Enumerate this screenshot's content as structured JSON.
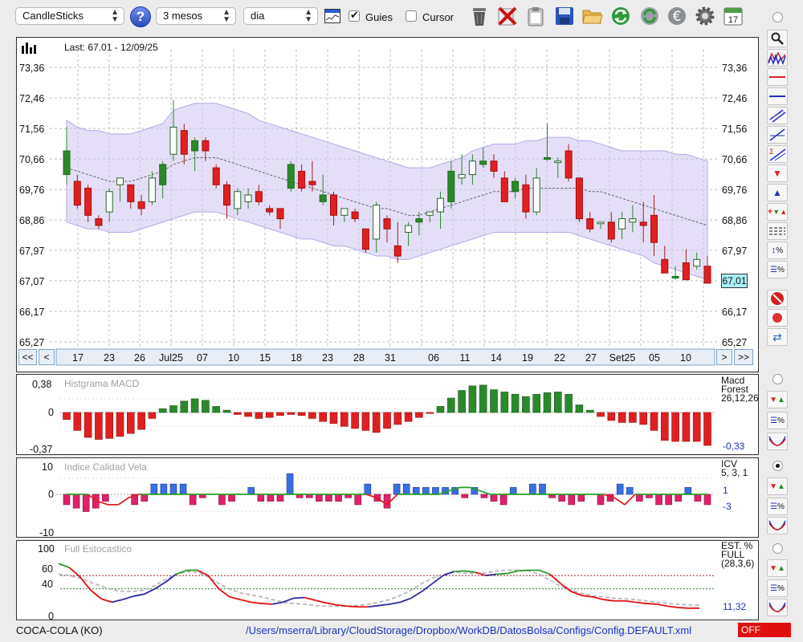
{
  "toolbar": {
    "chart_type": "CandleSticks",
    "period": "3 mesos",
    "interval": "dia",
    "guides_label": "Guies",
    "guides_checked": true,
    "cursor_label": "Cursor",
    "cursor_checked": false,
    "calendar_day": "17",
    "help_glyph": "?",
    "icons": [
      "help-icon",
      "chart-window-icon",
      "trash-icon",
      "delete-icon",
      "clipboard-icon",
      "save-icon",
      "folder-icon",
      "refresh-icon",
      "update-icon",
      "euro-icon",
      "settings-icon",
      "calendar-icon"
    ]
  },
  "main_chart": {
    "last_label": "Last: 67.01 - 12/09/25",
    "current_value": "67,01",
    "price_axis": [
      "73,36",
      "72,46",
      "71,56",
      "70,66",
      "69,76",
      "68,86",
      "67,97",
      "67,07",
      "66,17",
      "65,27"
    ],
    "date_labels": [
      "17",
      "23",
      "26",
      "Jul25",
      "07",
      "10",
      "15",
      "18",
      "23",
      "28",
      "31",
      "06",
      "11",
      "14",
      "19",
      "22",
      "27",
      "Set25",
      "05",
      "10"
    ],
    "nav": {
      "first": "<<",
      "prev": "<",
      "next": ">",
      "last": ">>"
    }
  },
  "macd": {
    "title": "Histgrama MACD",
    "axis": [
      "0,38",
      "0",
      "-0,37"
    ],
    "name_line1": "Macd",
    "name_line2": "Forest",
    "params": "26,12,26",
    "value": "-0,33"
  },
  "icv": {
    "title": "Indice Calidad Vela",
    "axis": [
      "10",
      "0",
      "-10"
    ],
    "name": "ICV",
    "params": "5, 3, 1",
    "value1": "1",
    "value2": "-3"
  },
  "stoch": {
    "title": "Full Estocastico",
    "axis": [
      "100",
      "60",
      "40",
      "0"
    ],
    "name_line1": "EST. %",
    "name_line2": "FULL",
    "params": "(28,3,6)",
    "value": "11,32"
  },
  "status": {
    "symbol": "COCA-COLA (KO)",
    "path": "/Users/mserra/Library/CloudStorage/Dropbox/WorkDB/DatosBolsa/Configs/Config.DEFAULT.xml",
    "mode": "OFF"
  },
  "colors": {
    "up": "#2a8a2a",
    "down": "#e02020",
    "band": "#cdc4f0",
    "accent": "#2030c0",
    "highlight": "#a8f0f8"
  },
  "chart_data": [
    {
      "type": "candlestick",
      "title": "Last: 67.01 - 12/09/25",
      "ylim": [
        65.27,
        73.36
      ],
      "y_ticks": [
        73.36,
        72.46,
        71.56,
        70.66,
        69.76,
        68.86,
        67.97,
        67.07,
        66.17,
        65.27
      ],
      "x_tick_labels": [
        "17",
        "23",
        "26",
        "Jul25",
        "07",
        "10",
        "15",
        "18",
        "23",
        "28",
        "31",
        "06",
        "11",
        "14",
        "19",
        "22",
        "27",
        "Set25",
        "05",
        "10"
      ],
      "candles": [
        {
          "o": 70.2,
          "h": 71.6,
          "l": 69.9,
          "c": 70.9
        },
        {
          "o": 70.0,
          "h": 70.2,
          "l": 69.2,
          "c": 69.3
        },
        {
          "o": 69.8,
          "h": 69.9,
          "l": 68.8,
          "c": 69.0
        },
        {
          "o": 68.9,
          "h": 69.0,
          "l": 68.6,
          "c": 68.7
        },
        {
          "o": 69.1,
          "h": 69.8,
          "l": 68.8,
          "c": 69.7
        },
        {
          "o": 69.9,
          "h": 70.1,
          "l": 69.4,
          "c": 70.1
        },
        {
          "o": 69.9,
          "h": 69.9,
          "l": 69.2,
          "c": 69.4
        },
        {
          "o": 69.4,
          "h": 69.6,
          "l": 69.0,
          "c": 69.2
        },
        {
          "o": 69.4,
          "h": 70.3,
          "l": 69.3,
          "c": 70.1
        },
        {
          "o": 69.9,
          "h": 70.6,
          "l": 69.5,
          "c": 70.5
        },
        {
          "o": 70.8,
          "h": 72.4,
          "l": 70.6,
          "c": 71.6
        },
        {
          "o": 71.5,
          "h": 71.7,
          "l": 70.5,
          "c": 70.8
        },
        {
          "o": 70.9,
          "h": 71.3,
          "l": 70.3,
          "c": 71.2
        },
        {
          "o": 71.2,
          "h": 71.3,
          "l": 70.6,
          "c": 70.9
        },
        {
          "o": 70.4,
          "h": 70.5,
          "l": 69.8,
          "c": 69.9
        },
        {
          "o": 69.9,
          "h": 70.0,
          "l": 68.9,
          "c": 69.3
        },
        {
          "o": 69.2,
          "h": 69.8,
          "l": 69.0,
          "c": 69.7
        },
        {
          "o": 69.4,
          "h": 69.8,
          "l": 69.2,
          "c": 69.6
        },
        {
          "o": 69.7,
          "h": 69.9,
          "l": 69.3,
          "c": 69.4
        },
        {
          "o": 69.2,
          "h": 69.3,
          "l": 69.0,
          "c": 69.1
        },
        {
          "o": 69.2,
          "h": 69.2,
          "l": 68.6,
          "c": 68.9
        },
        {
          "o": 69.8,
          "h": 70.6,
          "l": 69.7,
          "c": 70.5
        },
        {
          "o": 70.3,
          "h": 70.5,
          "l": 69.7,
          "c": 69.8
        },
        {
          "o": 70.0,
          "h": 70.6,
          "l": 69.7,
          "c": 69.9
        },
        {
          "o": 69.4,
          "h": 70.2,
          "l": 69.3,
          "c": 69.6
        },
        {
          "o": 69.6,
          "h": 69.7,
          "l": 68.7,
          "c": 69.0
        },
        {
          "o": 69.0,
          "h": 69.2,
          "l": 68.8,
          "c": 69.2
        },
        {
          "o": 69.1,
          "h": 69.2,
          "l": 68.8,
          "c": 68.9
        },
        {
          "o": 68.6,
          "h": 68.6,
          "l": 67.9,
          "c": 68.0
        },
        {
          "o": 68.3,
          "h": 69.4,
          "l": 67.9,
          "c": 69.3
        },
        {
          "o": 68.9,
          "h": 69.0,
          "l": 68.2,
          "c": 68.6
        },
        {
          "o": 68.1,
          "h": 68.8,
          "l": 67.6,
          "c": 67.8
        },
        {
          "o": 68.5,
          "h": 68.8,
          "l": 68.1,
          "c": 68.7
        },
        {
          "o": 68.8,
          "h": 69.1,
          "l": 68.4,
          "c": 68.9
        },
        {
          "o": 69.0,
          "h": 69.1,
          "l": 68.8,
          "c": 69.1
        },
        {
          "o": 69.1,
          "h": 69.7,
          "l": 68.6,
          "c": 69.5
        },
        {
          "o": 69.4,
          "h": 70.6,
          "l": 69.2,
          "c": 70.3
        },
        {
          "o": 70.1,
          "h": 70.8,
          "l": 69.9,
          "c": 70.2
        },
        {
          "o": 70.2,
          "h": 70.8,
          "l": 69.9,
          "c": 70.6
        },
        {
          "o": 70.5,
          "h": 71.0,
          "l": 70.4,
          "c": 70.6
        },
        {
          "o": 70.6,
          "h": 70.8,
          "l": 70.1,
          "c": 70.3
        },
        {
          "o": 70.1,
          "h": 70.3,
          "l": 69.4,
          "c": 69.4
        },
        {
          "o": 69.7,
          "h": 70.1,
          "l": 69.5,
          "c": 70.0
        },
        {
          "o": 69.9,
          "h": 70.2,
          "l": 68.9,
          "c": 69.1
        },
        {
          "o": 69.1,
          "h": 70.4,
          "l": 69.0,
          "c": 70.1
        },
        {
          "o": 70.7,
          "h": 71.7,
          "l": 70.6,
          "c": 70.7
        },
        {
          "o": 70.6,
          "h": 70.7,
          "l": 70.1,
          "c": 70.6
        },
        {
          "o": 70.9,
          "h": 71.1,
          "l": 70.0,
          "c": 70.1
        },
        {
          "o": 70.1,
          "h": 70.1,
          "l": 68.8,
          "c": 68.9
        },
        {
          "o": 68.9,
          "h": 69.1,
          "l": 68.5,
          "c": 68.6
        },
        {
          "o": 68.8,
          "h": 68.8,
          "l": 68.6,
          "c": 68.8
        },
        {
          "o": 68.8,
          "h": 69.1,
          "l": 68.2,
          "c": 68.3
        },
        {
          "o": 68.6,
          "h": 69.1,
          "l": 68.3,
          "c": 68.9
        },
        {
          "o": 68.8,
          "h": 69.3,
          "l": 68.5,
          "c": 68.9
        },
        {
          "o": 68.8,
          "h": 69.4,
          "l": 68.2,
          "c": 68.7
        },
        {
          "o": 69.0,
          "h": 69.6,
          "l": 67.8,
          "c": 68.2
        },
        {
          "o": 67.7,
          "h": 68.1,
          "l": 67.3,
          "c": 67.3
        },
        {
          "o": 67.2,
          "h": 67.5,
          "l": 67.1,
          "c": 67.2
        },
        {
          "o": 67.6,
          "h": 68.0,
          "l": 67.1,
          "c": 67.1
        },
        {
          "o": 67.5,
          "h": 67.9,
          "l": 67.4,
          "c": 67.7
        },
        {
          "o": 67.5,
          "h": 67.8,
          "l": 67.0,
          "c": 67.0
        }
      ],
      "bollinger_upper": [
        71.8,
        71.6,
        71.5,
        71.5,
        71.4,
        71.4,
        71.4,
        71.5,
        71.6,
        71.7,
        72.1,
        72.2,
        72.3,
        72.3,
        72.3,
        72.2,
        72.1,
        72.0,
        71.8,
        71.7,
        71.6,
        71.5,
        71.4,
        71.3,
        71.2,
        71.1,
        71.0,
        70.9,
        70.8,
        70.7,
        70.6,
        70.5,
        70.4,
        70.4,
        70.4,
        70.5,
        70.6,
        70.7,
        70.9,
        71.0,
        71.1,
        71.1,
        71.1,
        71.2,
        71.2,
        71.3,
        71.3,
        71.3,
        71.2,
        71.2,
        71.1,
        71.0,
        70.9,
        70.9,
        70.9,
        70.9,
        70.9,
        70.8,
        70.8,
        70.7,
        70.6
      ],
      "bollinger_lower": [
        68.8,
        68.7,
        68.6,
        68.6,
        68.5,
        68.5,
        68.5,
        68.6,
        68.7,
        68.8,
        68.9,
        69.0,
        69.1,
        69.1,
        69.1,
        69.0,
        68.9,
        68.8,
        68.7,
        68.6,
        68.5,
        68.4,
        68.3,
        68.3,
        68.2,
        68.1,
        68.1,
        68.0,
        67.9,
        67.8,
        67.8,
        67.7,
        67.7,
        67.8,
        67.9,
        68.0,
        68.1,
        68.2,
        68.3,
        68.4,
        68.5,
        68.5,
        68.5,
        68.5,
        68.5,
        68.5,
        68.5,
        68.5,
        68.4,
        68.3,
        68.2,
        68.1,
        68.0,
        67.9,
        67.8,
        67.6,
        67.5,
        67.4,
        67.3,
        67.2,
        67.1
      ],
      "moving_average": [
        70.4,
        70.3,
        70.2,
        70.1,
        70.0,
        70.0,
        70.0,
        70.1,
        70.2,
        70.3,
        70.5,
        70.6,
        70.7,
        70.7,
        70.7,
        70.6,
        70.5,
        70.4,
        70.3,
        70.2,
        70.1,
        70.0,
        69.9,
        69.8,
        69.7,
        69.6,
        69.5,
        69.4,
        69.3,
        69.2,
        69.2,
        69.1,
        69.0,
        69.0,
        69.1,
        69.2,
        69.3,
        69.4,
        69.5,
        69.6,
        69.7,
        69.7,
        69.7,
        69.8,
        69.8,
        69.8,
        69.8,
        69.8,
        69.8,
        69.7,
        69.7,
        69.6,
        69.5,
        69.4,
        69.3,
        69.2,
        69.1,
        69.0,
        68.9,
        68.8,
        68.7
      ]
    },
    {
      "type": "bar",
      "title": "Histgrama MACD",
      "ylim": [
        -0.37,
        0.38
      ],
      "values": [
        -0.07,
        -0.18,
        -0.25,
        -0.27,
        -0.26,
        -0.24,
        -0.21,
        -0.17,
        -0.06,
        0.05,
        0.09,
        0.15,
        0.18,
        0.16,
        0.08,
        0.03,
        -0.02,
        -0.04,
        -0.06,
        -0.05,
        -0.03,
        -0.02,
        -0.03,
        -0.06,
        -0.09,
        -0.11,
        -0.14,
        -0.16,
        -0.18,
        -0.2,
        -0.16,
        -0.12,
        -0.09,
        -0.05,
        -0.01,
        0.08,
        0.19,
        0.29,
        0.35,
        0.36,
        0.3,
        0.27,
        0.24,
        0.21,
        0.24,
        0.26,
        0.27,
        0.24,
        0.1,
        0.03,
        -0.04,
        -0.08,
        -0.1,
        -0.1,
        -0.12,
        -0.18,
        -0.28,
        -0.29,
        -0.29,
        -0.29,
        -0.33
      ]
    },
    {
      "type": "bar",
      "title": "Indice Calidad Vela",
      "ylim": [
        -10,
        10
      ],
      "values": [
        -3,
        -4,
        -5,
        -4,
        -2,
        0,
        0,
        -3,
        -2,
        3,
        3,
        3,
        3,
        -3,
        -1,
        0,
        -3,
        -2,
        0,
        2,
        -2,
        -2,
        -2,
        6,
        -1,
        -1,
        -2,
        -2,
        -2,
        -1,
        -3,
        3,
        -2,
        -4,
        3,
        3,
        2,
        2,
        2,
        2,
        2,
        -1,
        2,
        -1,
        -2,
        -3,
        2,
        0,
        3,
        3,
        -1,
        -2,
        -3,
        -2,
        0,
        -3,
        -2,
        3,
        2,
        -2,
        -1,
        -3,
        -3,
        -2,
        2,
        -2,
        -3
      ],
      "line": [
        0,
        0,
        0,
        -2,
        -3,
        -3,
        -1,
        0,
        0,
        0,
        0,
        0,
        0,
        0,
        0,
        0,
        0,
        0,
        0,
        0,
        0,
        0,
        0,
        0,
        0,
        0,
        0,
        0,
        0,
        0,
        -1,
        -3,
        0,
        0,
        0,
        0,
        0,
        1,
        2,
        2,
        1,
        0,
        0,
        0,
        0,
        0,
        0,
        0,
        0,
        0,
        0,
        0,
        0,
        -1,
        -3,
        0,
        0,
        0,
        0,
        0,
        0,
        0,
        0
      ]
    },
    {
      "type": "line",
      "title": "Full Estocastico",
      "ylim": [
        0,
        100
      ],
      "series": [
        {
          "values": [
            78,
            72,
            58,
            38,
            25,
            20,
            24,
            29,
            32,
            40,
            50,
            62,
            68,
            68,
            60,
            40,
            28,
            24,
            20,
            18,
            17,
            20,
            26,
            27,
            23,
            19,
            16,
            14,
            13,
            13,
            15,
            17,
            20,
            26,
            36,
            48,
            60,
            66,
            67,
            65,
            60,
            62,
            63,
            67,
            68,
            68,
            62,
            48,
            36,
            30,
            28,
            24,
            22,
            22,
            20,
            18,
            17,
            14,
            12,
            11,
            11
          ]
        },
        {
          "values": [
            62,
            60,
            56,
            50,
            44,
            39,
            36,
            36,
            38,
            45,
            54,
            62,
            66,
            65,
            58,
            48,
            40,
            34,
            31,
            28,
            24,
            20,
            18,
            17,
            15,
            14,
            14,
            14,
            15,
            17,
            20,
            24,
            30,
            38,
            48,
            56,
            62,
            65,
            64,
            63,
            64,
            67,
            68,
            68,
            67,
            62,
            53,
            44,
            38,
            33,
            30,
            28,
            26,
            25,
            24,
            22,
            20,
            18,
            17,
            16,
            16
          ]
        }
      ]
    }
  ]
}
